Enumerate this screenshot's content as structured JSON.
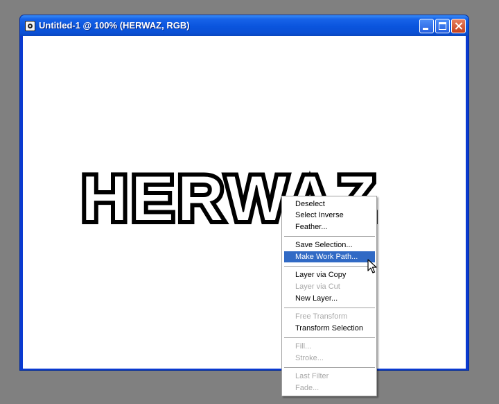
{
  "window": {
    "title": "Untitled-1 @ 100% (HERWAZ, RGB)"
  },
  "canvas": {
    "art_text": "HERWAZ"
  },
  "context_menu": {
    "items": [
      {
        "label": "Deselect",
        "enabled": true
      },
      {
        "label": "Select Inverse",
        "enabled": true
      },
      {
        "label": "Feather...",
        "enabled": true
      },
      {
        "label": "Save Selection...",
        "enabled": true
      },
      {
        "label": "Make Work Path...",
        "enabled": true,
        "highlighted": true
      },
      {
        "label": "Layer via Copy",
        "enabled": true
      },
      {
        "label": "Layer via Cut",
        "enabled": false
      },
      {
        "label": "New Layer...",
        "enabled": true
      },
      {
        "label": "Free Transform",
        "enabled": false
      },
      {
        "label": "Transform Selection",
        "enabled": true
      },
      {
        "label": "Fill...",
        "enabled": false
      },
      {
        "label": "Stroke...",
        "enabled": false
      },
      {
        "label": "Last Filter",
        "enabled": false
      },
      {
        "label": "Fade...",
        "enabled": false
      }
    ]
  },
  "icons": {
    "app": "photoshop-document-icon",
    "minimize": "minimize-icon",
    "maximize": "maximize-icon",
    "close": "close-icon",
    "cursor": "arrow-cursor-icon"
  },
  "colors": {
    "desktop": "#808080",
    "titlebar": "#0a54dd",
    "menu_highlight": "#316ac5",
    "disabled_text": "#a8a8a8"
  }
}
